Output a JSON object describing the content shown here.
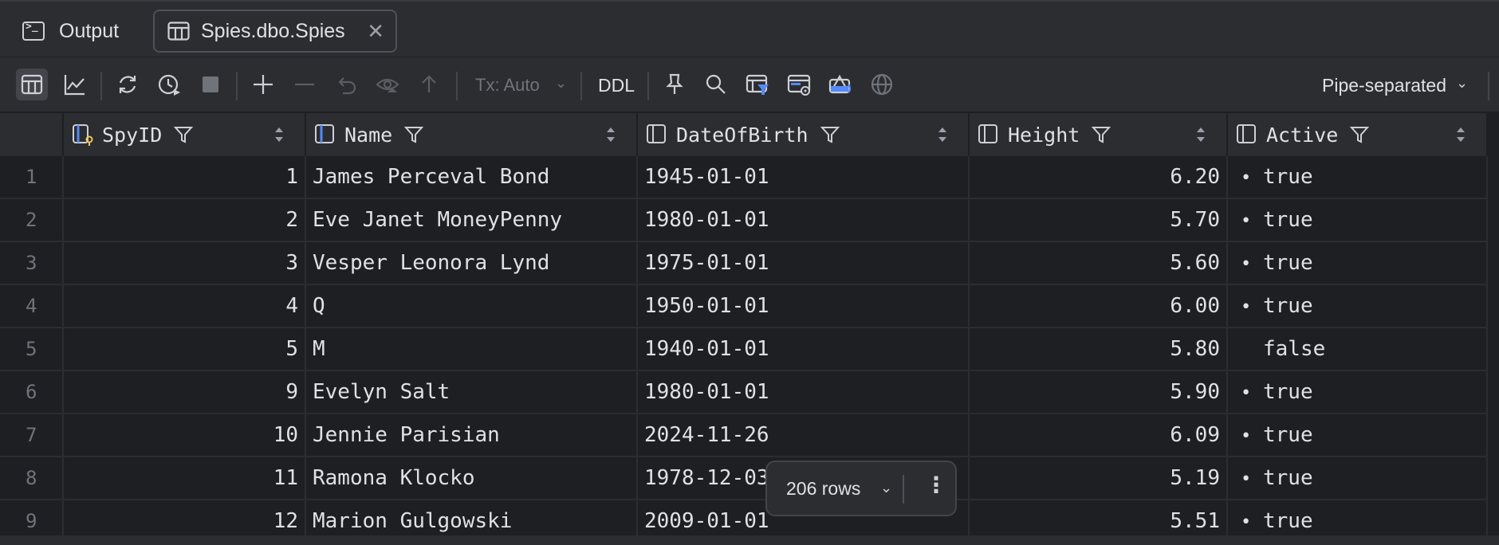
{
  "tabs": [
    {
      "label": "Output",
      "icon": "terminal-icon"
    },
    {
      "label": "Spies.dbo.Spies",
      "icon": "table-icon",
      "active": true
    }
  ],
  "toolbar": {
    "transaction_mode": "Tx: Auto",
    "ddl_label": "DDL",
    "export_format": "Pipe-separated",
    "icons": [
      "table-view-icon",
      "chart-view-icon",
      "refresh-icon",
      "history-icon",
      "stop-icon",
      "add-row-icon",
      "delete-row-icon",
      "revert-icon",
      "preview-changes-icon",
      "submit-icon",
      "pin-icon",
      "search-icon",
      "filter-view-icon",
      "data-editor-icon",
      "compare-icon",
      "globe-icon"
    ]
  },
  "columns": [
    {
      "name": "SpyID",
      "icon": "primary-key-column-icon"
    },
    {
      "name": "Name",
      "icon": "column-icon"
    },
    {
      "name": "DateOfBirth",
      "icon": "column-icon"
    },
    {
      "name": "Height",
      "icon": "column-icon"
    },
    {
      "name": "Active",
      "icon": "column-icon"
    }
  ],
  "rows": [
    {
      "n": "1",
      "SpyID": "1",
      "Name": "James Perceval Bond",
      "DateOfBirth": "1945-01-01",
      "Height": "6.20",
      "Active": "true"
    },
    {
      "n": "2",
      "SpyID": "2",
      "Name": "Eve Janet MoneyPenny",
      "DateOfBirth": "1980-01-01",
      "Height": "5.70",
      "Active": "true"
    },
    {
      "n": "3",
      "SpyID": "3",
      "Name": "Vesper Leonora Lynd",
      "DateOfBirth": "1975-01-01",
      "Height": "5.60",
      "Active": "true"
    },
    {
      "n": "4",
      "SpyID": "4",
      "Name": "Q",
      "DateOfBirth": "1950-01-01",
      "Height": "6.00",
      "Active": "true"
    },
    {
      "n": "5",
      "SpyID": "5",
      "Name": "M",
      "DateOfBirth": "1940-01-01",
      "Height": "5.80",
      "Active": "false"
    },
    {
      "n": "6",
      "SpyID": "9",
      "Name": "Evelyn Salt",
      "DateOfBirth": "1980-01-01",
      "Height": "5.90",
      "Active": "true"
    },
    {
      "n": "7",
      "SpyID": "10",
      "Name": "Jennie Parisian",
      "DateOfBirth": "2024-11-26",
      "Height": "6.09",
      "Active": "true"
    },
    {
      "n": "8",
      "SpyID": "11",
      "Name": "Ramona Klocko",
      "DateOfBirth": "1978-12-03",
      "Height": "5.19",
      "Active": "true"
    },
    {
      "n": "9",
      "SpyID": "12",
      "Name": "Marion Gulgowski",
      "DateOfBirth": "2009-01-01",
      "Height": "5.51",
      "Active": "true"
    }
  ],
  "footer": {
    "row_count": "206 rows"
  },
  "colors": {
    "background": "#1e1f22",
    "panel": "#2b2d30",
    "accent": "#548af7"
  }
}
